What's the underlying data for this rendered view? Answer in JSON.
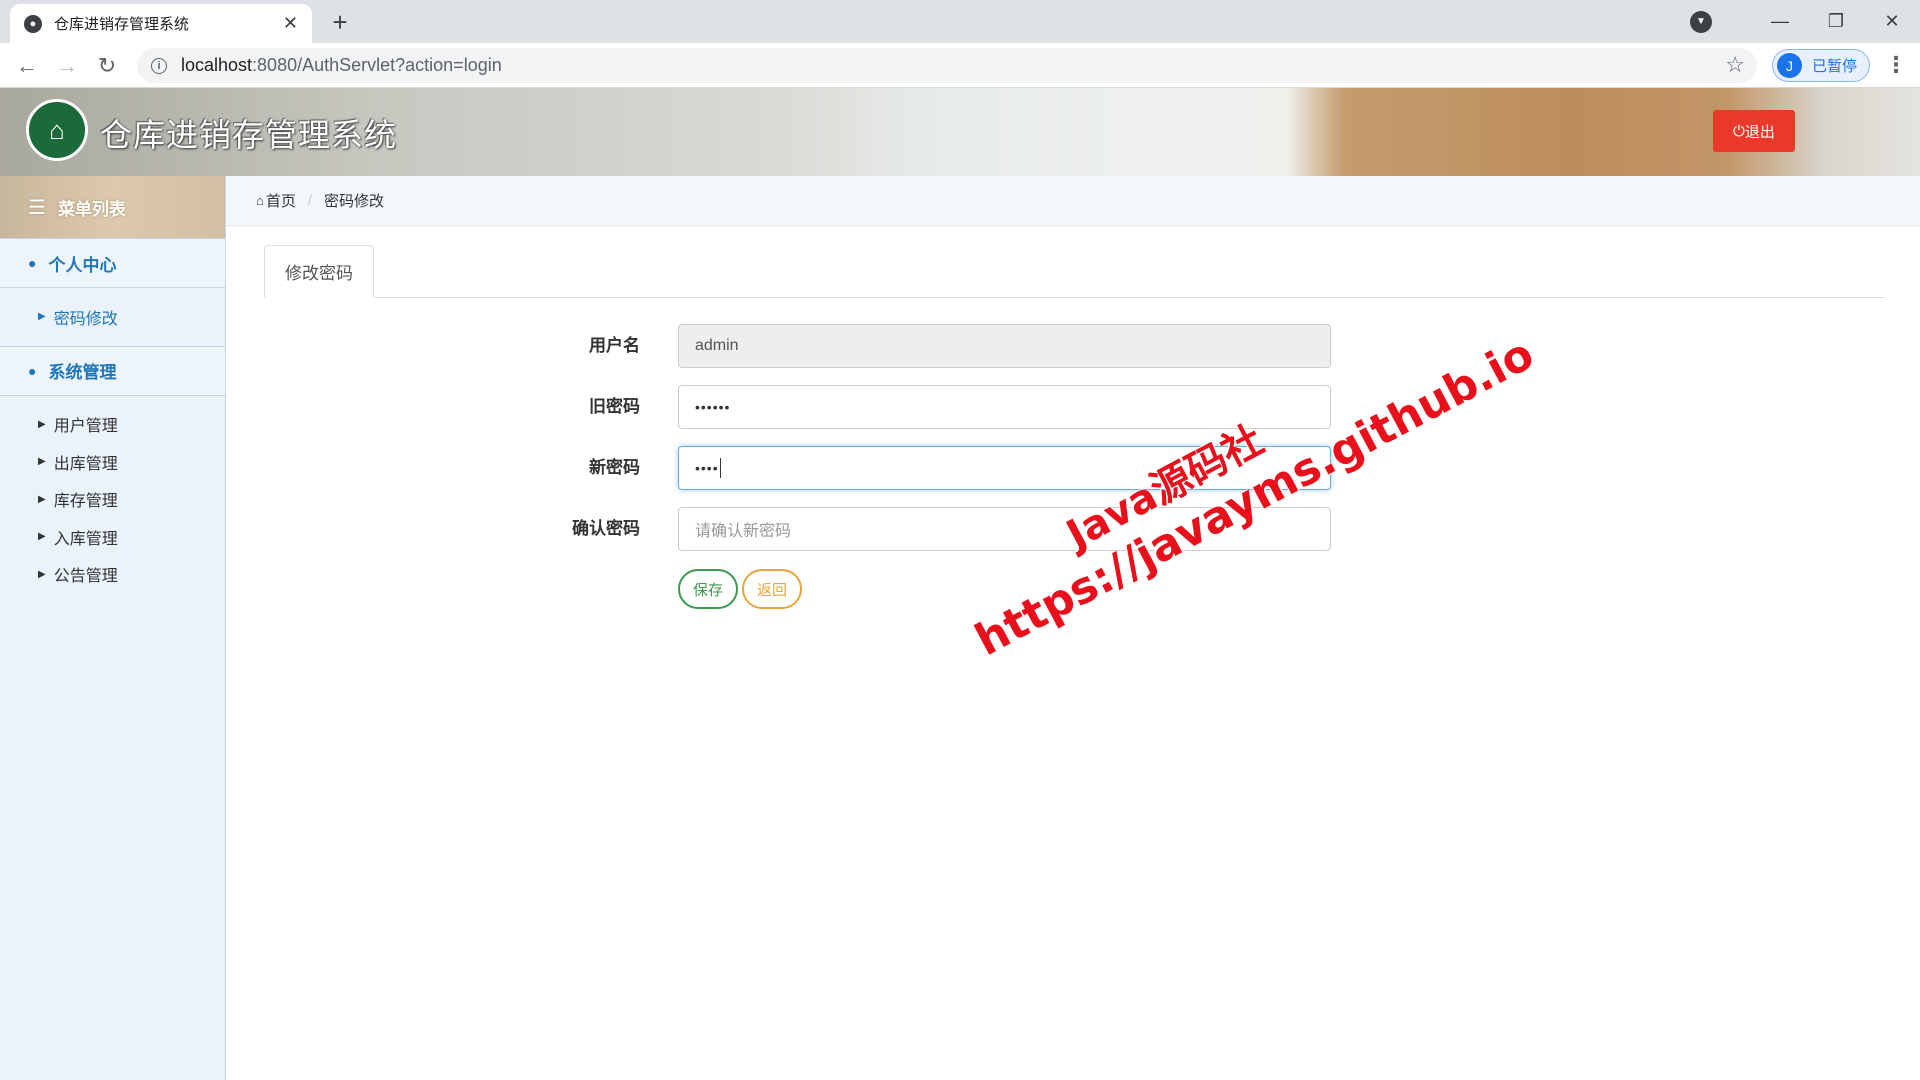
{
  "browser": {
    "tab_title": "仓库进销存管理系统",
    "tab_close": "✕",
    "new_tab": "+",
    "url_host": "localhost",
    "url_rest": ":8080/AuthServlet?action=login",
    "profile_initial": "J",
    "profile_label": "已暂停",
    "back": "←",
    "forward": "→",
    "reload": "↻",
    "star": "☆",
    "menu": "⋮",
    "minimize": "—",
    "restore": "❐",
    "close": "✕"
  },
  "header": {
    "title": "仓库进销存管理系统",
    "logout_label": "退出",
    "logout_icon": "⏻"
  },
  "sidebar": {
    "title": "菜单列表",
    "groups": [
      {
        "label": "个人中心",
        "items": [
          {
            "label": "密码修改",
            "active": true
          }
        ]
      },
      {
        "label": "系统管理",
        "items": [
          {
            "label": "用户管理"
          },
          {
            "label": "出库管理"
          },
          {
            "label": "库存管理"
          },
          {
            "label": "入库管理"
          },
          {
            "label": "公告管理"
          }
        ]
      }
    ]
  },
  "breadcrumb": {
    "home": "首页",
    "current": "密码修改"
  },
  "tab": {
    "label": "修改密码"
  },
  "form": {
    "username_label": "用户名",
    "username_value": "admin",
    "old_password_label": "旧密码",
    "old_password_mask": "••••••",
    "new_password_label": "新密码",
    "new_password_mask": "••••",
    "confirm_label": "确认密码",
    "confirm_placeholder": "请确认新密码",
    "save_label": "保存",
    "back_label": "返回"
  },
  "watermark": {
    "line1": "Java源码社",
    "line2": "https://javayms.github.io"
  },
  "colors": {
    "accent_blue": "#1f76b8",
    "logout_red": "#e8392a",
    "save_green": "#3c9a4b",
    "back_orange": "#e8a53a",
    "watermark_red": "#e8101a"
  }
}
